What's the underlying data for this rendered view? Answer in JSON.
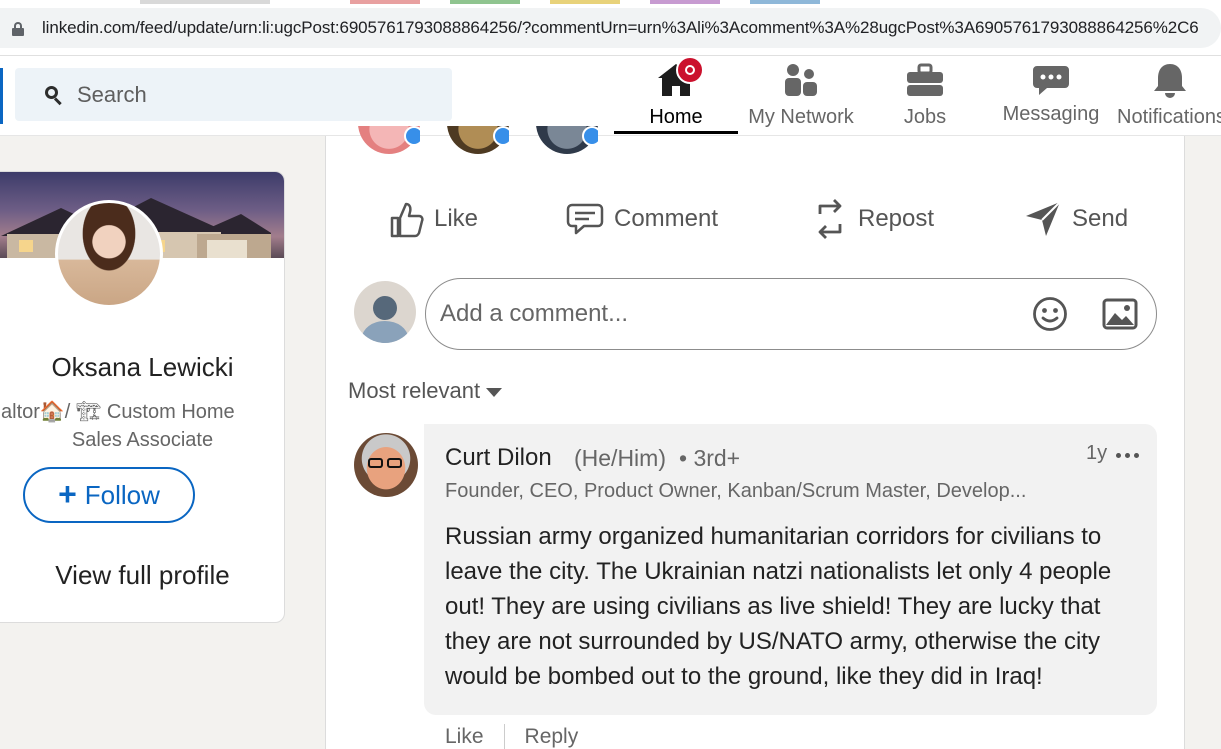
{
  "browser": {
    "url": "linkedin.com/feed/update/urn:li:ugcPost:6905761793088864256/?commentUrn=urn%3Ali%3Acomment%3A%28ugcPost%3A6905761793088864256%2C6"
  },
  "header": {
    "search_placeholder": "Search",
    "nav": {
      "home": "Home",
      "network": "My Network",
      "jobs": "Jobs",
      "messaging": "Messaging",
      "notifications": "Notifications"
    }
  },
  "profile": {
    "name": "Oksana Lewicki",
    "headline_line1": "altor🏠/ 🏗 Custom Home",
    "headline_line2": "Sales Associate",
    "follow_label": "Follow",
    "view_profile": "View full profile"
  },
  "post_actions": {
    "like": "Like",
    "comment": "Comment",
    "repost": "Repost",
    "send": "Send"
  },
  "comment_input": {
    "placeholder": "Add a comment..."
  },
  "sort": {
    "label": "Most relevant"
  },
  "comment": {
    "author": "Curt Dilon",
    "pronouns": "(He/Him)",
    "degree": "• 3rd+",
    "time": "1y",
    "headline": "Founder, CEO, Product Owner, Kanban/Scrum Master, Develop...",
    "text": "Russian army organized humanitarian corridors for civilians to leave the city. The Ukrainian natzi nationalists let only 4 people out! They are using civilians as live shield! They are lucky that they are not surrounded by US/NATO army, otherwise the city would be bombed out to the ground, like they did in Iraq!",
    "like_label": "Like",
    "reply_label": "Reply"
  },
  "colors": {
    "brand_blue": "#0a66c2",
    "notification_red": "#cb112d",
    "background": "#f3f2ef"
  }
}
